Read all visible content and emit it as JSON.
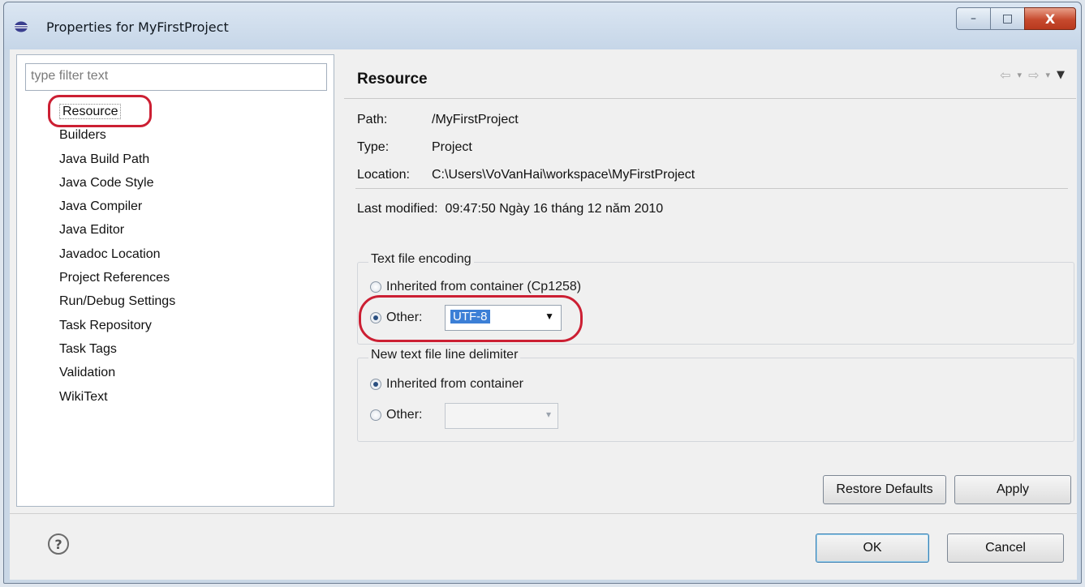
{
  "window": {
    "title": "Properties for MyFirstProject"
  },
  "window_buttons": {
    "minimize": "–",
    "maximize": "□",
    "close": "X"
  },
  "filter": {
    "placeholder": "type filter text"
  },
  "tree": {
    "items": [
      "Resource",
      "Builders",
      "Java Build Path",
      "Java Code Style",
      "Java Compiler",
      "Java Editor",
      "Javadoc Location",
      "Project References",
      "Run/Debug Settings",
      "Task Repository",
      "Task Tags",
      "Validation",
      "WikiText"
    ],
    "selected": "Resource"
  },
  "page": {
    "title": "Resource",
    "path_label": "Path:",
    "path_value": "/MyFirstProject",
    "type_label": "Type:",
    "type_value": "Project",
    "location_label": "Location:",
    "location_value": "C:\\Users\\VoVanHai\\workspace\\MyFirstProject",
    "modified_label": "Last modified:",
    "modified_value": "09:47:50 Ngày 16 tháng 12 năm 2010"
  },
  "encoding": {
    "group_title": "Text file encoding",
    "inherited_label": "Inherited from container (Cp1258)",
    "other_label": "Other:",
    "other_value": "UTF-8",
    "selected": "other"
  },
  "delimiter": {
    "group_title": "New text file line delimiter",
    "inherited_label": "Inherited from container",
    "other_label": "Other:",
    "selected": "inherited"
  },
  "buttons": {
    "restore_defaults": "Restore Defaults",
    "apply": "Apply",
    "ok": "OK",
    "cancel": "Cancel",
    "help": "?"
  },
  "colors": {
    "annotation_red": "#cc1f33",
    "selection_blue": "#3c7fd6"
  }
}
